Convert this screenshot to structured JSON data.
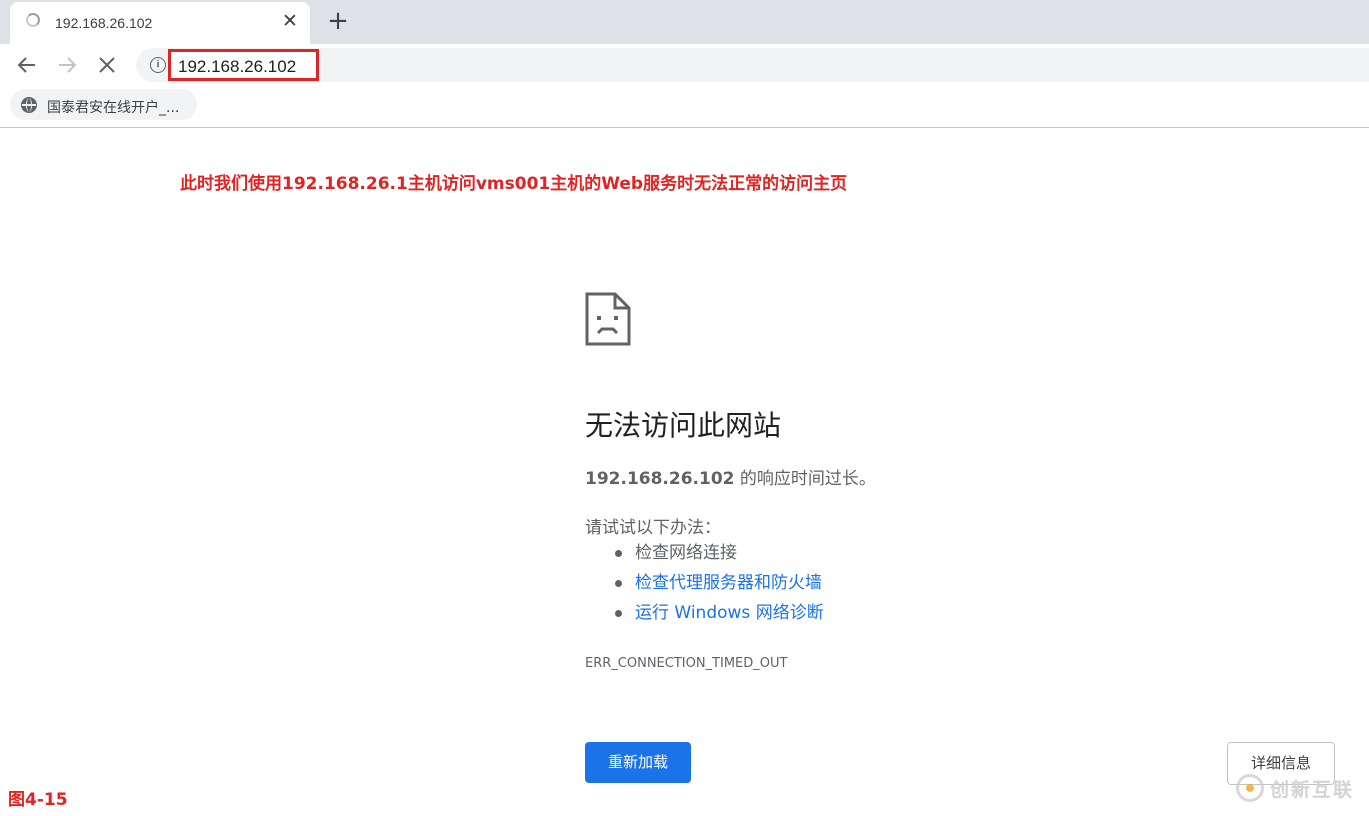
{
  "tab": {
    "title": "192.168.26.102"
  },
  "toolbar": {
    "url": "192.168.26.102"
  },
  "bookmarks": [
    {
      "label": "国泰君安在线开户_..."
    }
  ],
  "annotation": "此时我们使用192.168.26.1主机访问vms001主机的Web服务时无法正常的访问主页",
  "error": {
    "title": "无法访问此网站",
    "host": "192.168.26.102",
    "description_suffix": " 的响应时间过长。",
    "suggest_heading": "请试试以下办法：",
    "suggestions": [
      {
        "label": "检查网络连接",
        "link": false
      },
      {
        "label": "检查代理服务器和防火墙",
        "link": true
      },
      {
        "label": "运行 Windows 网络诊断",
        "link": true
      }
    ],
    "code": "ERR_CONNECTION_TIMED_OUT",
    "reload_label": "重新加载",
    "details_label": "详细信息"
  },
  "figure_label": "图4-15",
  "watermark": "创新互联",
  "colors": {
    "link": "#1a73e8",
    "annotation": "#e02424",
    "button": "#1a73e8"
  },
  "icons": [
    "loading-spinner-icon",
    "close-icon",
    "plus-icon",
    "back-arrow-icon",
    "forward-arrow-icon",
    "stop-icon",
    "info-icon",
    "globe-icon",
    "sad-page-icon"
  ]
}
